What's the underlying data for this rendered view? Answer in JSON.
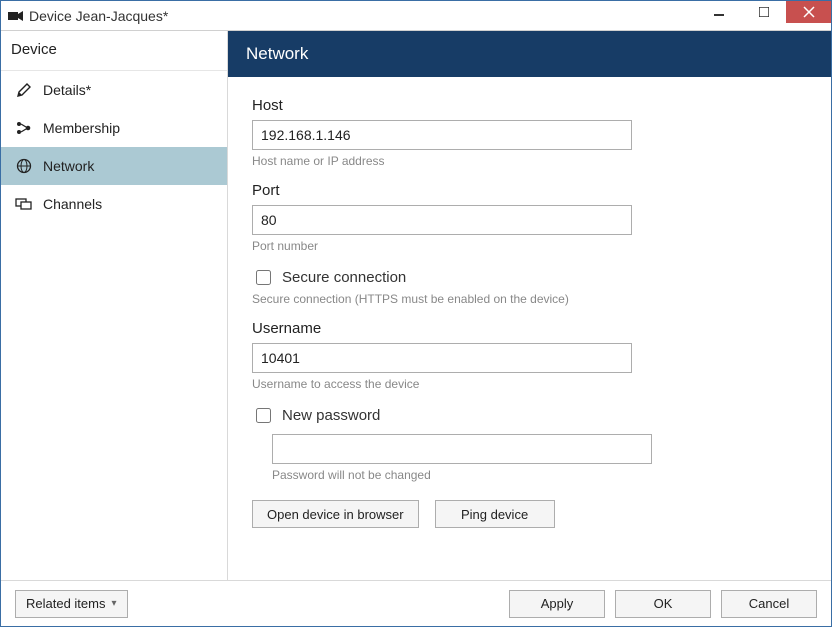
{
  "window": {
    "title": "Device Jean-Jacques*"
  },
  "sidebar": {
    "header": "Device",
    "items": [
      {
        "label": "Details*",
        "icon": "pencil"
      },
      {
        "label": "Membership",
        "icon": "nodes"
      },
      {
        "label": "Network",
        "icon": "globe"
      },
      {
        "label": "Channels",
        "icon": "monitors"
      }
    ]
  },
  "main": {
    "title": "Network",
    "host": {
      "label": "Host",
      "value": "192.168.1.146",
      "help": "Host name or IP address"
    },
    "port": {
      "label": "Port",
      "value": "80",
      "help": "Port number"
    },
    "secure": {
      "label": "Secure connection",
      "help": "Secure connection (HTTPS must be enabled on the device)"
    },
    "username": {
      "label": "Username",
      "value": "10401",
      "help": "Username to access the device"
    },
    "newpass": {
      "label": "New password",
      "help": "Password will not be changed"
    },
    "open_browser": "Open device in browser",
    "ping": "Ping device"
  },
  "footer": {
    "related": "Related items",
    "apply": "Apply",
    "ok": "OK",
    "cancel": "Cancel"
  }
}
